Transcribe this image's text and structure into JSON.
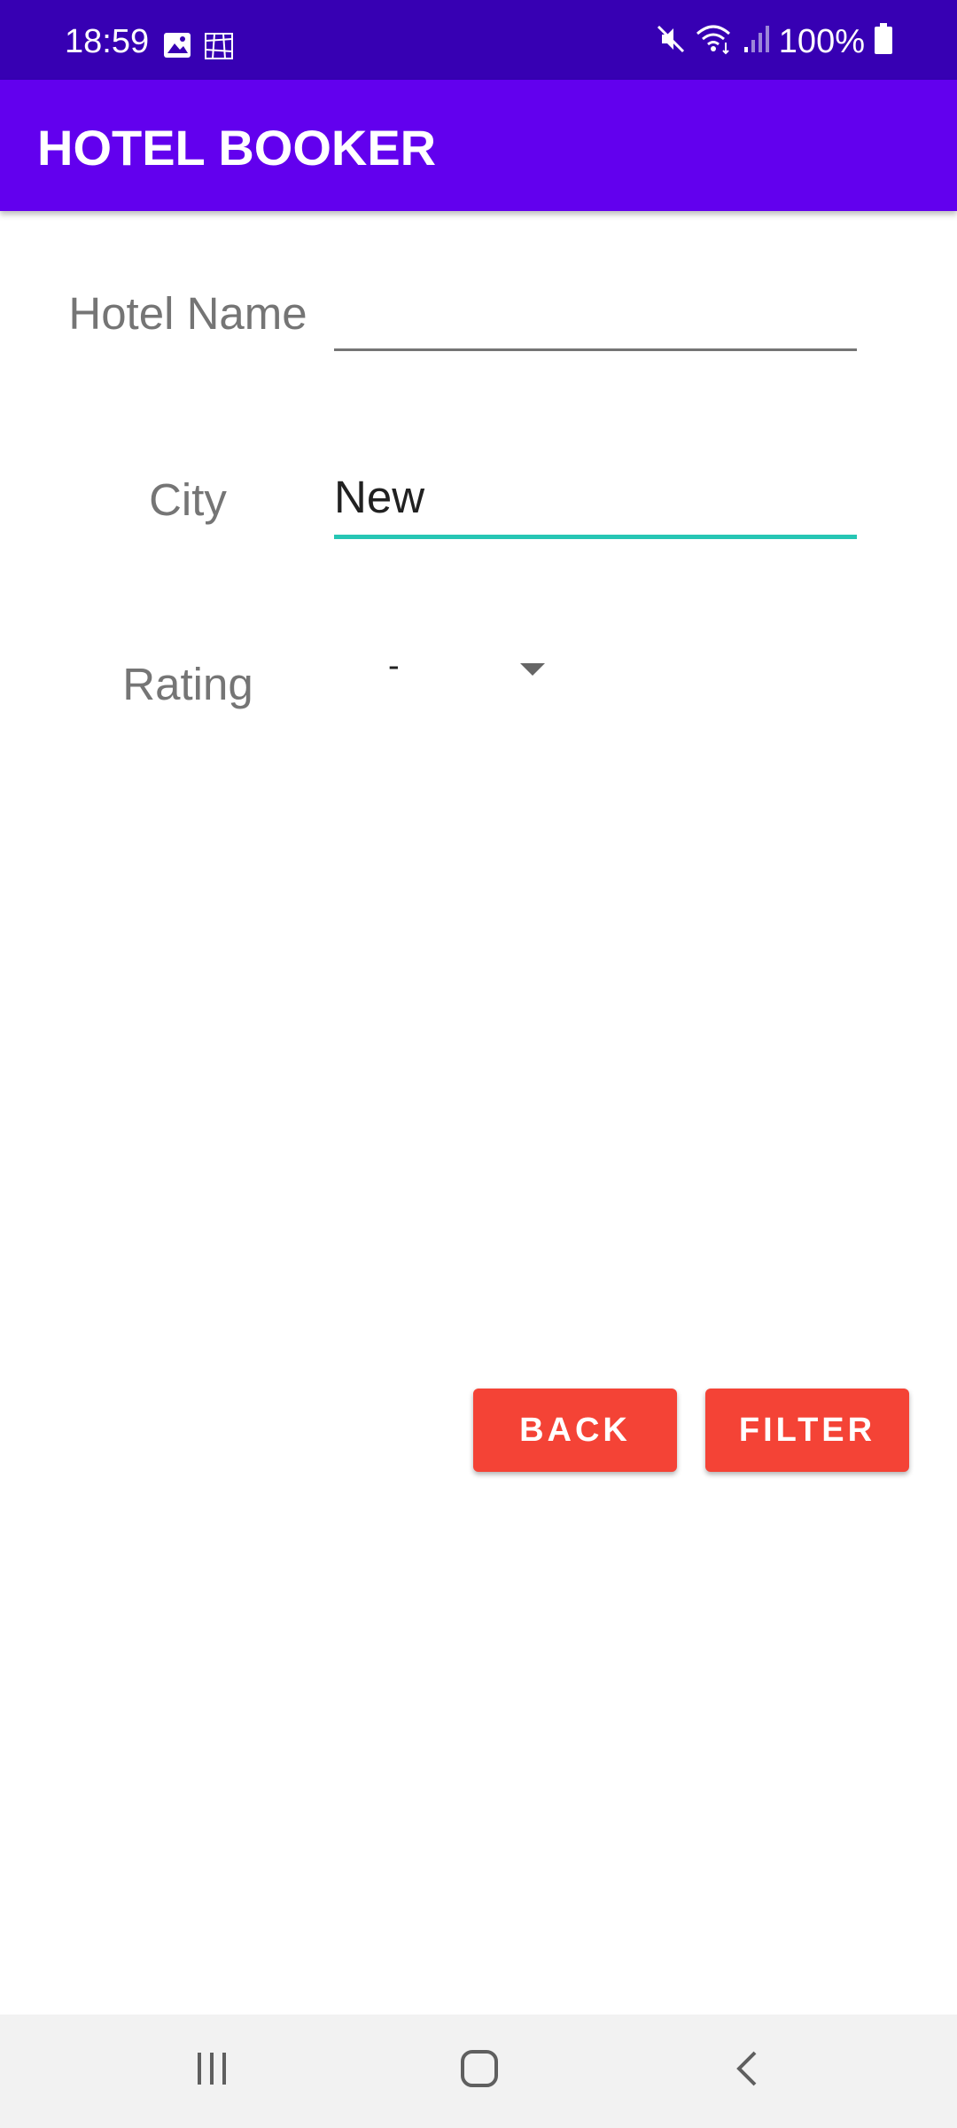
{
  "status_bar": {
    "time": "18:59",
    "battery": "100%",
    "left_icons": [
      "image-icon",
      "gallery-icon"
    ],
    "right_icons": [
      "mute-icon",
      "wifi-icon",
      "signal-icon",
      "battery-icon"
    ]
  },
  "app_bar": {
    "title": "HOTEL BOOKER",
    "color": "#6200ee"
  },
  "form": {
    "hotel_name": {
      "label": "Hotel Name",
      "value": ""
    },
    "city": {
      "label": "City",
      "value": "New"
    },
    "rating": {
      "label": "Rating",
      "selected": "-"
    }
  },
  "actions": {
    "back_label": "BACK",
    "filter_label": "FILTER",
    "button_color": "#f44336"
  },
  "nav_bar": {
    "items": [
      "recents-icon",
      "home-icon",
      "back-icon"
    ]
  },
  "colors": {
    "status_bar": "#3700b3",
    "focus_underline": "#26c6b4"
  }
}
